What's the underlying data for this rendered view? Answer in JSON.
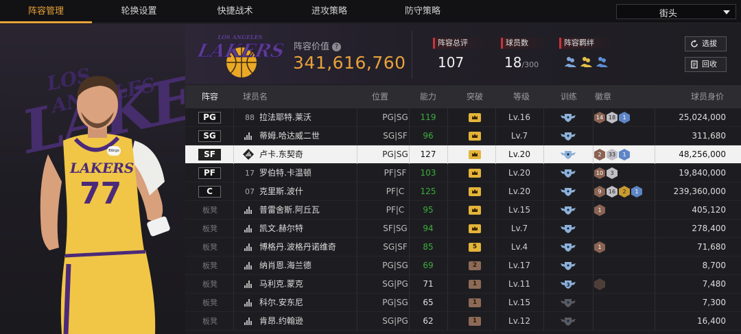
{
  "nav": {
    "tabs": [
      "阵容管理",
      "轮换设置",
      "快捷战术",
      "进攻策略",
      "防守策略"
    ],
    "active_tab": 0,
    "mode_select": "街头"
  },
  "team": {
    "logo_text": "LAKERS",
    "logo_arc_text": "LOS ANGELES",
    "value_label": "阵容价值",
    "value": "341,616,760",
    "accent_color": "#e8a23a"
  },
  "hero": {
    "bg_text": "LAKERS",
    "bg_arc_text": "LOS ANGELES",
    "jersey_team": "LAKERS",
    "jersey_number": "77",
    "badge": "Bibigo"
  },
  "stats": {
    "rating_label": "阵容总评",
    "rating": "107",
    "players_label": "球员数",
    "players": "18",
    "players_max": "/300",
    "chem_label": "阵容羁绊"
  },
  "buttons": {
    "select": "选拔",
    "recycle": "回收"
  },
  "table": {
    "headers": {
      "lineup": "阵容",
      "name": "球员名",
      "position": "位置",
      "ability": "能力",
      "breakthrough": "突破",
      "level": "等级",
      "training": "训练",
      "badges": "徽章",
      "salary": "球员身价"
    },
    "rows": [
      {
        "slot": "PG",
        "starter": true,
        "num": "88",
        "name": "拉法耶特.莱沃",
        "pos": "PG|SG",
        "ovr": "119",
        "ovr_color": "green",
        "brk": "",
        "brk_type": "gold",
        "lv": "Lv.16",
        "train": "",
        "badges": [
          {
            "t": "bz",
            "v": "14"
          },
          {
            "t": "sv",
            "v": "18"
          },
          {
            "t": "hof",
            "v": "1"
          }
        ],
        "salary": "25,024,000",
        "selected": false
      },
      {
        "slot": "SG",
        "starter": true,
        "num": "",
        "name": "蒂姆.哈达威二世",
        "pos": "SG|SF",
        "ovr": "96",
        "ovr_color": "green",
        "brk": "",
        "brk_type": "gold",
        "lv": "Lv.7",
        "train": "",
        "badges": [],
        "salary": "311,680",
        "selected": false
      },
      {
        "slot": "SF",
        "starter": true,
        "num": "",
        "name": "卢卡.东契奇",
        "pos": "PG|SG",
        "ovr": "127",
        "ovr_color": "white",
        "brk": "",
        "brk_type": "gold",
        "lv": "Lv.20",
        "train": "",
        "badges": [
          {
            "t": "bz",
            "v": "2"
          },
          {
            "t": "sv",
            "v": "33"
          },
          {
            "t": "hof",
            "v": "1"
          }
        ],
        "salary": "48,256,000",
        "selected": true
      },
      {
        "slot": "PF",
        "starter": true,
        "num": "17",
        "name": "罗伯特.卡温顿",
        "pos": "PF|SF",
        "ovr": "103",
        "ovr_color": "green",
        "brk": "",
        "brk_type": "gold",
        "lv": "Lv.20",
        "train": "",
        "badges": [
          {
            "t": "bz",
            "v": "10"
          },
          {
            "t": "sv",
            "v": "3"
          }
        ],
        "salary": "19,840,000",
        "selected": false
      },
      {
        "slot": "C",
        "starter": true,
        "num": "07",
        "name": "克里斯.波什",
        "pos": "PF|C",
        "ovr": "125",
        "ovr_color": "green",
        "brk": "",
        "brk_type": "gold",
        "lv": "Lv.20",
        "train": "",
        "badges": [
          {
            "t": "bz",
            "v": "9"
          },
          {
            "t": "sv",
            "v": "16"
          },
          {
            "t": "gd",
            "v": "2"
          },
          {
            "t": "hof",
            "v": "1"
          }
        ],
        "salary": "239,360,000",
        "selected": false
      },
      {
        "slot": "板凳",
        "starter": false,
        "num": "",
        "name": "普雷舍斯.阿丘瓦",
        "pos": "PF|C",
        "ovr": "95",
        "ovr_color": "green",
        "brk": "",
        "brk_type": "gold",
        "lv": "Lv.15",
        "train": "",
        "badges": [
          {
            "t": "bz",
            "v": "1"
          }
        ],
        "salary": "405,120",
        "selected": false
      },
      {
        "slot": "板凳",
        "starter": false,
        "num": "",
        "name": "凯文.赫尔特",
        "pos": "SF|SG",
        "ovr": "94",
        "ovr_color": "green",
        "brk": "",
        "brk_type": "gold",
        "lv": "Lv.7",
        "train": "",
        "badges": [],
        "salary": "278,400",
        "selected": false
      },
      {
        "slot": "板凳",
        "starter": false,
        "num": "",
        "name": "博格丹.波格丹诺维奇",
        "pos": "SG|SF",
        "ovr": "85",
        "ovr_color": "green",
        "brk": "5",
        "brk_type": "gold",
        "lv": "Lv.4",
        "train": "",
        "badges": [
          {
            "t": "bz",
            "v": "1"
          }
        ],
        "salary": "71,680",
        "selected": false
      },
      {
        "slot": "板凳",
        "starter": false,
        "num": "",
        "name": "纳肖恩.海兰德",
        "pos": "PG|SG",
        "ovr": "69",
        "ovr_color": "green",
        "brk": "2",
        "brk_type": "bronze",
        "lv": "Lv.17",
        "train": "",
        "badges": [],
        "salary": "8,700",
        "selected": false
      },
      {
        "slot": "板凳",
        "starter": false,
        "num": "",
        "name": "马利克.蒙克",
        "pos": "SG|PG",
        "ovr": "71",
        "ovr_color": "white",
        "brk": "1",
        "brk_type": "bronze",
        "lv": "Lv.11",
        "train": "3",
        "badges": [
          {
            "t": "dim",
            "v": ""
          }
        ],
        "salary": "7,480",
        "selected": false
      },
      {
        "slot": "板凳",
        "starter": false,
        "num": "",
        "name": "科尔.安东尼",
        "pos": "PG|SG",
        "ovr": "65",
        "ovr_color": "white",
        "brk": "1",
        "brk_type": "bronze",
        "lv": "Lv.15",
        "train": "",
        "badges": [],
        "salary": "7,300",
        "selected": false
      },
      {
        "slot": "板凳",
        "starter": false,
        "num": "",
        "name": "肯昂.约翰逊",
        "pos": "SG|PG",
        "ovr": "62",
        "ovr_color": "white",
        "brk": "1",
        "brk_type": "bronze",
        "lv": "Lv.12",
        "train": "",
        "badges": [],
        "salary": "16,400",
        "selected": false
      }
    ]
  },
  "icons": {
    "help": "question-icon",
    "select": "refresh-icon",
    "recycle": "recycle-icon",
    "dropdown": "chevron-down-icon",
    "breakthrough": "crown-icon",
    "training": "shield-wings-icon",
    "signal": "signal-bars-icon",
    "chem": "team-people-icon"
  }
}
